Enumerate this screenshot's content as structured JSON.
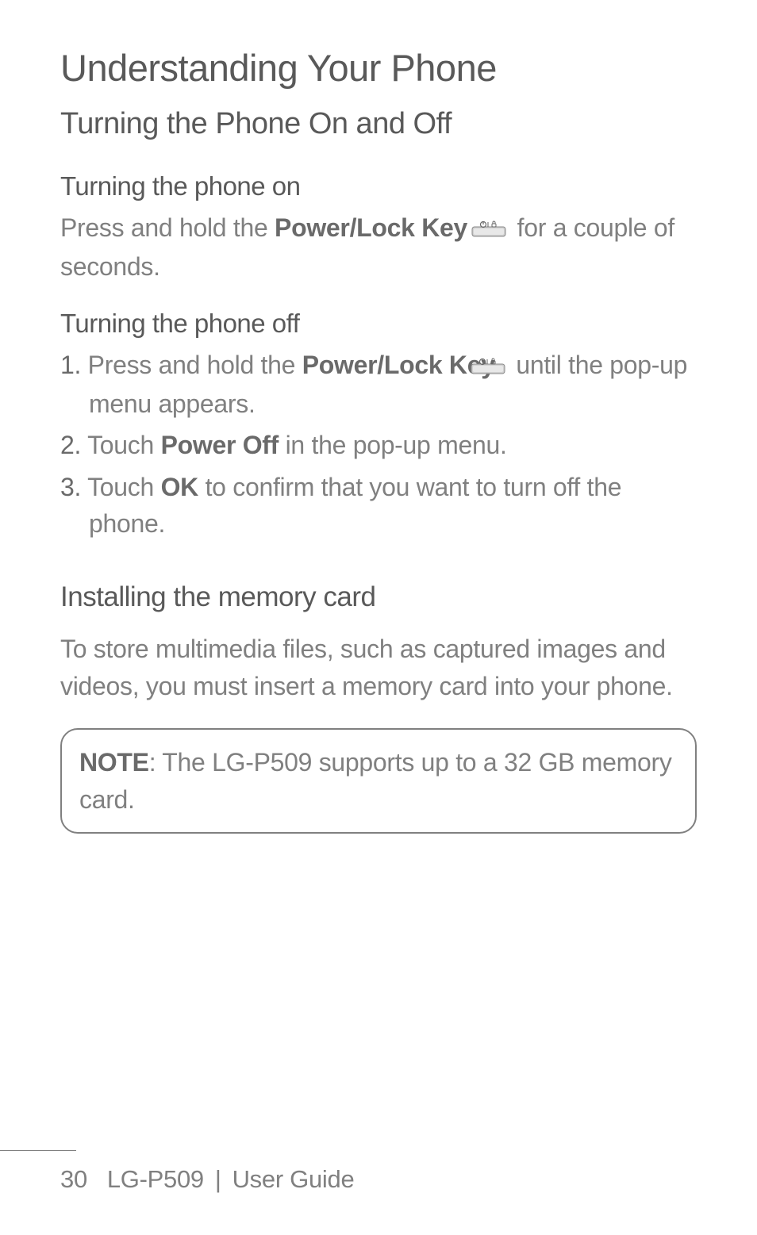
{
  "page": {
    "title": "Understanding Your Phone",
    "section1": {
      "heading": "Turning the Phone On and Off",
      "sub1": {
        "heading": "Turning the phone on",
        "text_before": "Press and hold the ",
        "text_bold": "Power/Lock Key",
        "text_after": "  for a couple of seconds."
      },
      "sub2": {
        "heading": "Turning the phone off",
        "items": [
          {
            "marker": "1.",
            "pre": " Press and hold the ",
            "bold": "Power/Lock Key",
            "post": "  until the pop-up menu appears.",
            "has_icon": true
          },
          {
            "marker": "2.",
            "pre": " Touch ",
            "bold": "Power Off",
            "post": " in the pop-up menu.",
            "has_icon": false
          },
          {
            "marker": "3.",
            "pre": " Touch ",
            "bold": "OK",
            "post": " to confirm that you want to turn off the phone.",
            "has_icon": false
          }
        ]
      }
    },
    "section2": {
      "heading": "Installing the memory card",
      "body": "To store multimedia files, such as captured images and videos, you must insert a memory card into your phone.",
      "note_label": "NOTE",
      "note_text": ": The LG-P509 supports up to a 32 GB memory card."
    },
    "footer": {
      "page_num": "30",
      "model": "LG-P509",
      "doc": "User Guide"
    }
  }
}
